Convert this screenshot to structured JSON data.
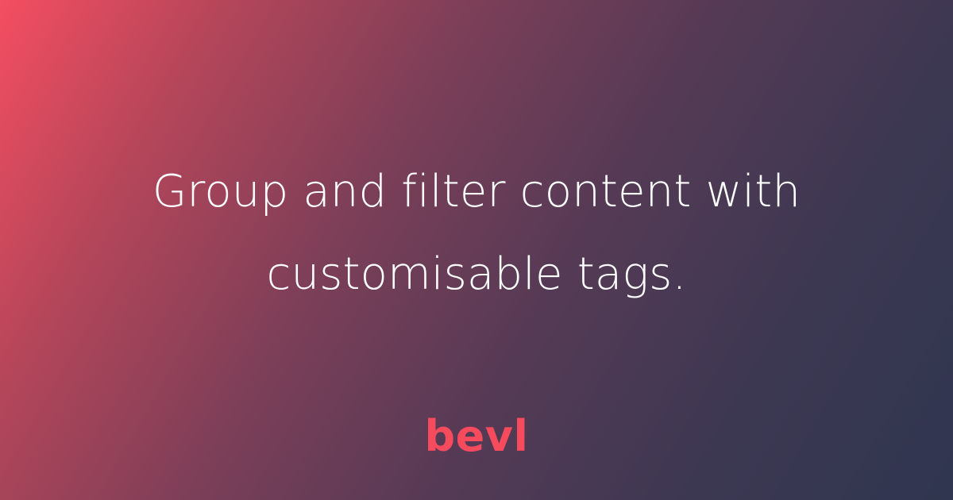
{
  "headline": {
    "line1": "Group and filter content with",
    "line2": "customisable tags."
  },
  "logo": {
    "text": "bevl"
  },
  "colors": {
    "gradient_start": "#f44e61",
    "gradient_end": "#30364f",
    "headline_text": "#ffffff",
    "logo": "#f64b5d"
  }
}
